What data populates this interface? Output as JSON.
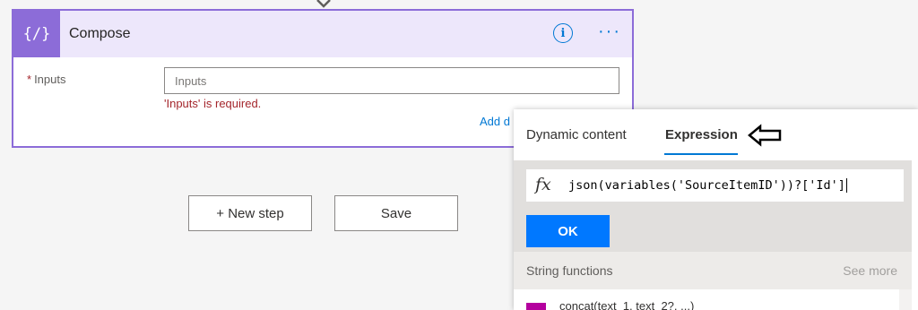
{
  "compose": {
    "title": "Compose",
    "icon": "braces-icon",
    "inputs_label": "Inputs",
    "required_marker": "*",
    "inputs_placeholder": "Inputs",
    "error": "'Inputs' is required.",
    "add_link": "Add d"
  },
  "actions": {
    "new_step": "+ New step",
    "save": "Save"
  },
  "expression_panel": {
    "tabs": [
      {
        "label": "Dynamic content",
        "active": false
      },
      {
        "label": "Expression",
        "active": true
      }
    ],
    "fx_symbol": "fx",
    "expression": "json(variables('SourceItemID'))?['Id']",
    "ok_label": "OK",
    "function_group": "String functions",
    "see_more": "See more",
    "functions": [
      "concat(text_1, text_2?, ...)"
    ]
  },
  "colors": {
    "accent": "#0078d4",
    "compose_purple": "#8c6cd8",
    "error_red": "#a4262c",
    "ok_blue": "#0078ff",
    "function_magenta": "#b4009e"
  }
}
